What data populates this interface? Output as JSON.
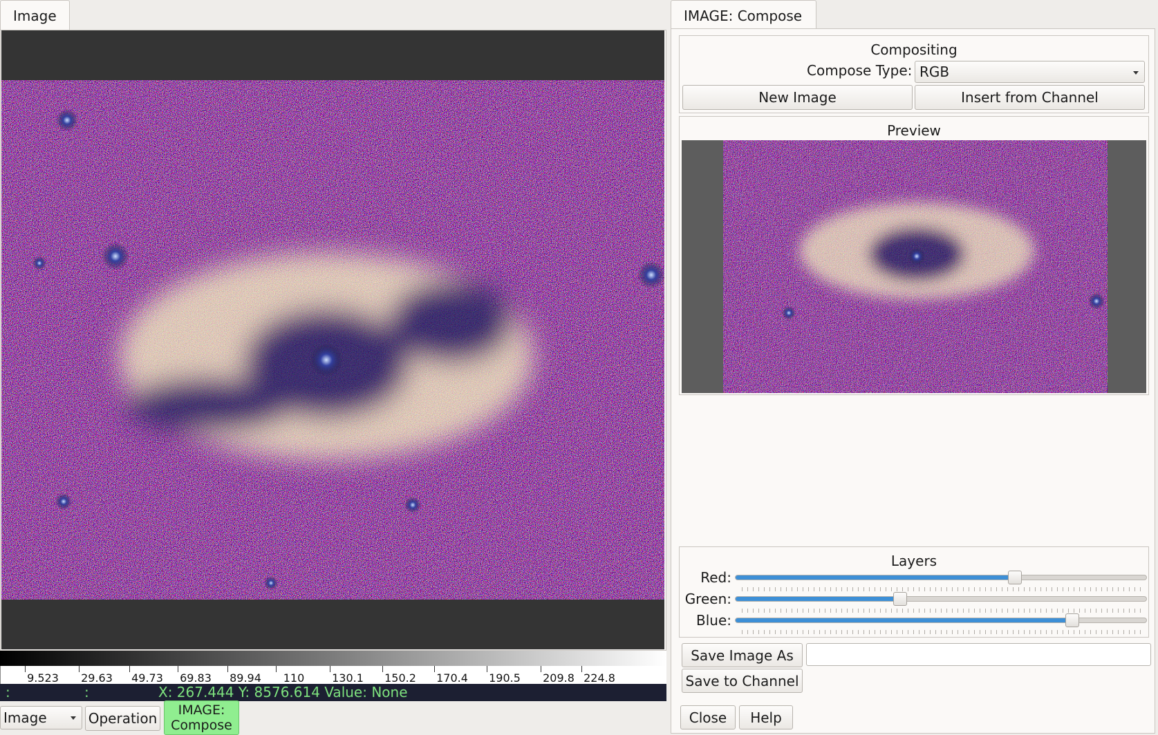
{
  "left_panel": {
    "tab_label": "Image",
    "colorbar": {
      "ticks": [
        "9.523",
        "29.63",
        "49.73",
        "69.83",
        "89.94",
        "110",
        "130.1",
        "150.2",
        "170.4",
        "190.5",
        "209.8",
        "224.8"
      ]
    },
    "status": {
      "left1": ":",
      "left2": ":",
      "coords": "X: 267.444  Y: 8576.614  Value: None"
    },
    "plugin_select_value": "Image",
    "operation_label": "Operation",
    "active_plugin_line1": "IMAGE:",
    "active_plugin_line2": "Compose",
    "active_color": "#90ee90"
  },
  "compose_panel": {
    "tab_label": "IMAGE: Compose",
    "compositing": {
      "title": "Compositing",
      "compose_type_label": "Compose Type:",
      "compose_type_value": "RGB",
      "new_image_label": "New Image",
      "insert_label": "Insert from Channel"
    },
    "preview": {
      "title": "Preview"
    },
    "layers": {
      "title": "Layers",
      "sliders": [
        {
          "label": "Red:",
          "value": 0.68
        },
        {
          "label": "Green:",
          "value": 0.4
        },
        {
          "label": "Blue:",
          "value": 0.82
        }
      ],
      "fill_color": "#3d8fd6"
    },
    "save_image_label": "Save Image As",
    "save_path_value": "",
    "save_channel_label": "Save to Channel",
    "close_label": "Close",
    "help_label": "Help"
  },
  "icons": {
    "dropdown": "chevron-down-icon"
  }
}
